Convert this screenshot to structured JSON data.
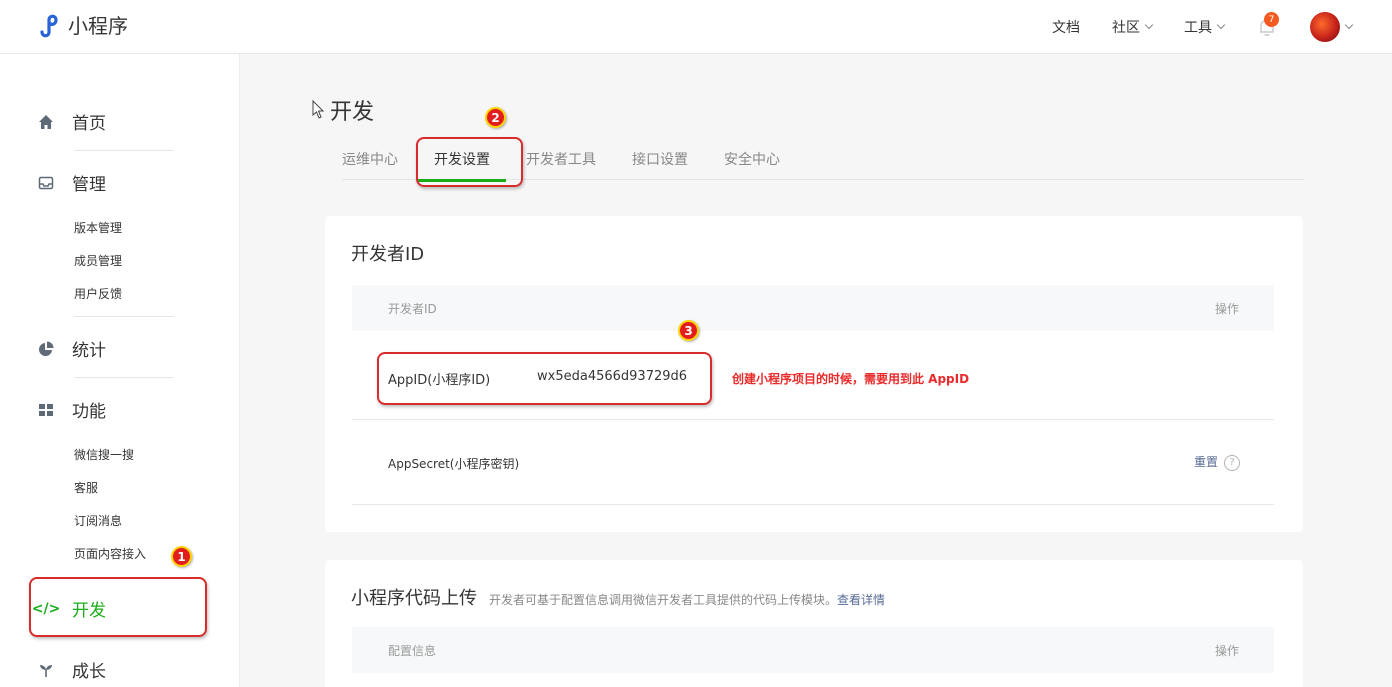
{
  "header": {
    "logo_text": "小程序",
    "nav": {
      "docs": "文档",
      "community": "社区",
      "tools": "工具"
    },
    "notification_count": "7"
  },
  "sidebar": {
    "home": "首页",
    "manage": "管理",
    "manage_items": [
      "版本管理",
      "成员管理",
      "用户反馈"
    ],
    "stats": "统计",
    "features": "功能",
    "feature_items": [
      "微信搜一搜",
      "客服",
      "订阅消息",
      "页面内容接入"
    ],
    "develop": "开发",
    "grow": "成长"
  },
  "main": {
    "title": "开发",
    "tabs": [
      "运维中心",
      "开发设置",
      "开发者工具",
      "接口设置",
      "安全中心"
    ],
    "dev_id_card": {
      "title": "开发者ID",
      "col_id": "开发者ID",
      "col_action": "操作",
      "appid_label": "AppID(小程序ID)",
      "appid_value": "wx5eda4566d93729d6",
      "appid_note": "创建小程序项目的时候，需要用到此 AppID",
      "secret_label": "AppSecret(小程序密钥)",
      "secret_action": "重置",
      "help_glyph": "?"
    },
    "upload_card": {
      "title": "小程序代码上传",
      "desc": "开发者可基于配置信息调用微信开发者工具提供的代码上传模块。",
      "desc_link": "查看详情",
      "col_config": "配置信息",
      "col_action": "操作"
    }
  },
  "annotations": {
    "step1": "1",
    "step2": "2",
    "step3": "3"
  },
  "colors": {
    "accent_green": "#1aad19",
    "annotation_red": "#d92b2b",
    "link_blue": "#576b95"
  }
}
